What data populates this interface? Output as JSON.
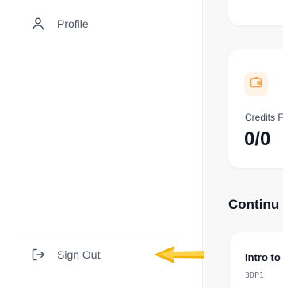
{
  "sidebar": {
    "items": [
      {
        "label": "Profile",
        "icon": "user-icon"
      }
    ],
    "sign_out": {
      "label": "Sign Out",
      "icon": "sign-out-icon"
    }
  },
  "annotation": {
    "icon": "arrow-left-icon",
    "color": "#f5b301"
  },
  "main": {
    "credits_card": {
      "label": "Credits F",
      "value": "0/0",
      "icon": "wallet-icon",
      "accent": "#f59e42"
    },
    "continue_section": {
      "title": "Continu",
      "course": {
        "title": "Intro to",
        "code": "3DP1"
      }
    }
  }
}
